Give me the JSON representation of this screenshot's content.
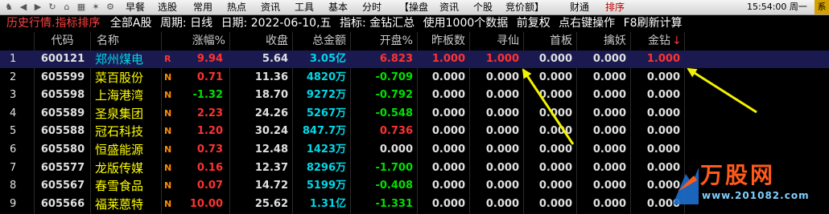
{
  "toolbar": {
    "menus": [
      "早餐",
      "选股",
      "常用",
      "热点",
      "资讯",
      "工具",
      "基本",
      "分时",
      "【操盘",
      "资讯",
      "个股",
      "竞价额】",
      "财通",
      "排序"
    ],
    "clock": "15:54:00 周一",
    "edge_label": "系"
  },
  "infobar": {
    "title": "历史行情.指标排序",
    "scope": "全部A股",
    "period": "周期: 日线",
    "date": "日期: 2022-06-10,五",
    "indicator": "指标: 金钻汇总",
    "data_used": "使用1000个数据",
    "adjust": "前复权",
    "rightclick": "点右键操作",
    "refresh": "F8刷新计算"
  },
  "columns": [
    "代码",
    "名称",
    "涨幅%",
    "收盘",
    "总金额",
    "开盘%",
    "昨板数",
    "寻仙",
    "首板",
    "擒妖",
    "金钻"
  ],
  "sort_arrow": "↓",
  "rows": [
    {
      "idx": "1",
      "code": "600121",
      "name": "郑州煤电",
      "flag": "R",
      "chg": "9.94",
      "close": "5.64",
      "amount": "3.05亿",
      "open": "6.823",
      "yb": "1.000",
      "xx": "1.000",
      "sb": "0.000",
      "qy": "0.000",
      "jz": "1.000"
    },
    {
      "idx": "2",
      "code": "605599",
      "name": "菜百股份",
      "flag": "N",
      "chg": "0.71",
      "close": "11.36",
      "amount": "4820万",
      "open": "-0.709",
      "yb": "0.000",
      "xx": "0.000",
      "sb": "0.000",
      "qy": "0.000",
      "jz": "0.000"
    },
    {
      "idx": "3",
      "code": "605598",
      "name": "上海港湾",
      "flag": "N",
      "chg": "-1.32",
      "close": "18.70",
      "amount": "9272万",
      "open": "-0.792",
      "yb": "0.000",
      "xx": "0.000",
      "sb": "0.000",
      "qy": "0.000",
      "jz": "0.000"
    },
    {
      "idx": "4",
      "code": "605589",
      "name": "圣泉集团",
      "flag": "N",
      "chg": "2.23",
      "close": "24.26",
      "amount": "5267万",
      "open": "-0.548",
      "yb": "0.000",
      "xx": "0.000",
      "sb": "0.000",
      "qy": "0.000",
      "jz": "0.000"
    },
    {
      "idx": "5",
      "code": "605588",
      "name": "冠石科技",
      "flag": "N",
      "chg": "1.20",
      "close": "30.24",
      "amount": "847.7万",
      "open": "0.736",
      "yb": "0.000",
      "xx": "0.000",
      "sb": "0.000",
      "qy": "0.000",
      "jz": "0.000"
    },
    {
      "idx": "6",
      "code": "605580",
      "name": "恒盛能源",
      "flag": "N",
      "chg": "0.73",
      "close": "12.48",
      "amount": "1423万",
      "open": "0.000",
      "yb": "0.000",
      "xx": "0.000",
      "sb": "0.000",
      "qy": "0.000",
      "jz": "0.000"
    },
    {
      "idx": "7",
      "code": "605577",
      "name": "龙版传媒",
      "flag": "N",
      "chg": "0.16",
      "close": "12.37",
      "amount": "8296万",
      "open": "-1.700",
      "yb": "0.000",
      "xx": "0.000",
      "sb": "0.000",
      "qy": "0.000",
      "jz": "0.000"
    },
    {
      "idx": "8",
      "code": "605567",
      "name": "春雪食品",
      "flag": "N",
      "chg": "0.07",
      "close": "14.72",
      "amount": "5199万",
      "open": "-0.408",
      "yb": "0.000",
      "xx": "0.000",
      "sb": "0.000",
      "qy": "0.000",
      "jz": "0.000"
    },
    {
      "idx": "9",
      "code": "605566",
      "name": "福莱蒽特",
      "flag": "N",
      "chg": "10.00",
      "close": "25.62",
      "amount": "1.31亿",
      "open": "-1.331",
      "yb": "0.000",
      "xx": "0.000",
      "sb": "0.000",
      "qy": "0.000",
      "jz": "0.000"
    }
  ],
  "watermark": {
    "title": "万股网",
    "url": "www.201082.com"
  },
  "colors": {
    "up": "#ff3232",
    "down": "#00e000",
    "flat": "#e0e0e0",
    "amount": "#00d8e8",
    "name": "#ffff00",
    "selected_name": "#00d8e8",
    "annotation_arrow": "#f2f200"
  }
}
